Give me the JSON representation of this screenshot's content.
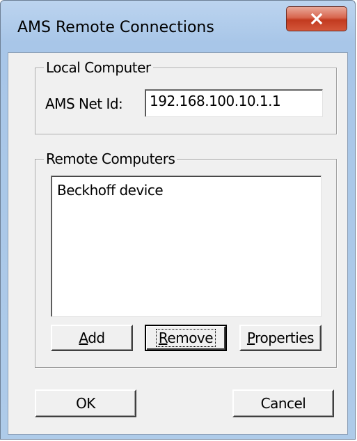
{
  "window": {
    "title": "AMS Remote Connections",
    "close_icon": "close-icon"
  },
  "local_group": {
    "label": "Local Computer",
    "net_id_label": "AMS Net Id:",
    "net_id_value": "192.168.100.10.1.1"
  },
  "remote_group": {
    "label": "Remote Computers",
    "items": [
      "Beckhoff device"
    ],
    "buttons": {
      "add": {
        "mnemonic": "A",
        "rest": "dd"
      },
      "remove": {
        "mnemonic": "R",
        "rest": "emove"
      },
      "properties": {
        "mnemonic": "P",
        "rest": "roperties"
      }
    }
  },
  "footer": {
    "ok_label": "OK",
    "cancel_label": "Cancel"
  },
  "colors": {
    "close_button": "#d4573a",
    "dialog_face": "#f0f0f0",
    "frame": "#aecbe9"
  }
}
